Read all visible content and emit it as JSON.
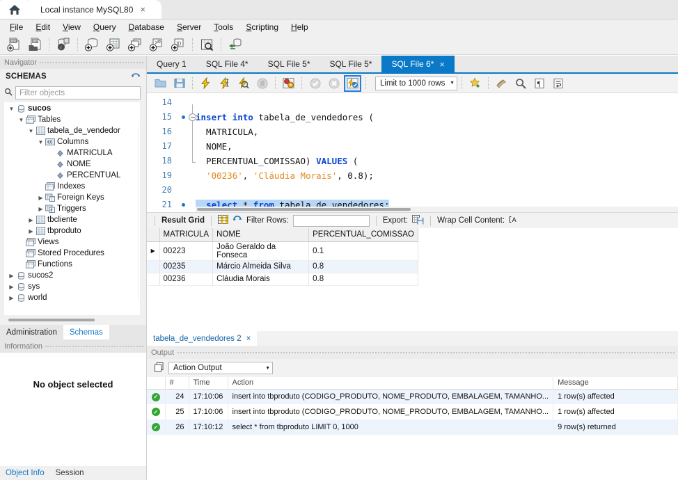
{
  "titlebar": {
    "home_icon": "home-icon",
    "instance_tab": "Local instance MySQL80",
    "close_glyph": "×"
  },
  "menubar": {
    "items": [
      {
        "label": "File"
      },
      {
        "label": "Edit"
      },
      {
        "label": "View"
      },
      {
        "label": "Query"
      },
      {
        "label": "Database"
      },
      {
        "label": "Server"
      },
      {
        "label": "Tools"
      },
      {
        "label": "Scripting"
      },
      {
        "label": "Help"
      }
    ]
  },
  "main_toolbar": {
    "icons": [
      "new-sql-tab-icon",
      "open-sql-script-icon",
      "connection-info-icon",
      "new-schema-icon",
      "new-table-icon",
      "new-view-icon",
      "new-procedure-icon",
      "new-function-icon",
      "inspect-schema-icon",
      "reconnect-server-icon"
    ]
  },
  "navigator": {
    "title": "Navigator",
    "schemas_label": "SCHEMAS",
    "refresh_icon": "refresh-icon",
    "filter_placeholder": "Filter objects",
    "search_icon": "search-icon",
    "tree": [
      {
        "label": "sucos",
        "indent": 0,
        "arrow": "down",
        "icon": "schema-icon",
        "bold": true
      },
      {
        "label": "Tables",
        "indent": 1,
        "arrow": "down",
        "icon": "folder-tables-icon",
        "bold": false
      },
      {
        "label": "tabela_de_vendedor",
        "indent": 2,
        "arrow": "down",
        "icon": "table-icon",
        "bold": false
      },
      {
        "label": "Columns",
        "indent": 3,
        "arrow": "down",
        "icon": "columns-icon",
        "bold": false
      },
      {
        "label": "MATRICULA",
        "indent": 4,
        "arrow": "none",
        "icon": "column-icon",
        "bold": false
      },
      {
        "label": "NOME",
        "indent": 4,
        "arrow": "none",
        "icon": "column-icon",
        "bold": false
      },
      {
        "label": "PERCENTUAL",
        "indent": 4,
        "arrow": "none",
        "icon": "column-icon",
        "bold": false
      },
      {
        "label": "Indexes",
        "indent": 3,
        "arrow": "none",
        "icon": "folder-tables-icon",
        "bold": false
      },
      {
        "label": "Foreign Keys",
        "indent": 3,
        "arrow": "right",
        "icon": "folder-fk-icon",
        "bold": false
      },
      {
        "label": "Triggers",
        "indent": 3,
        "arrow": "right",
        "icon": "folder-trigger-icon",
        "bold": false
      },
      {
        "label": "tbcliente",
        "indent": 2,
        "arrow": "right",
        "icon": "table-icon",
        "bold": false
      },
      {
        "label": "tbproduto",
        "indent": 2,
        "arrow": "right",
        "icon": "table-icon",
        "bold": false
      },
      {
        "label": "Views",
        "indent": 1,
        "arrow": "none",
        "icon": "folder-views-icon",
        "bold": false
      },
      {
        "label": "Stored Procedures",
        "indent": 1,
        "arrow": "none",
        "icon": "folder-proc-icon",
        "bold": false
      },
      {
        "label": "Functions",
        "indent": 1,
        "arrow": "none",
        "icon": "folder-func-icon",
        "bold": false
      },
      {
        "label": "sucos2",
        "indent": 0,
        "arrow": "right",
        "icon": "schema-icon",
        "bold": false
      },
      {
        "label": "sys",
        "indent": 0,
        "arrow": "right",
        "icon": "schema-icon",
        "bold": false
      },
      {
        "label": "world",
        "indent": 0,
        "arrow": "right",
        "icon": "schema-icon",
        "bold": false
      }
    ],
    "tabs": [
      {
        "label": "Administration",
        "active": false
      },
      {
        "label": "Schemas",
        "active": true
      }
    ]
  },
  "information": {
    "title": "Information",
    "empty_text": "No object selected",
    "tabs": [
      {
        "label": "Object Info",
        "active": true
      },
      {
        "label": "Session",
        "active": false
      }
    ]
  },
  "editor": {
    "tabs": [
      {
        "label": "Query 1",
        "active": false,
        "closable": false
      },
      {
        "label": "SQL File 4*",
        "active": false,
        "closable": false
      },
      {
        "label": "SQL File 5*",
        "active": false,
        "closable": false
      },
      {
        "label": "SQL File 5*",
        "active": false,
        "closable": false
      },
      {
        "label": "SQL File 6*",
        "active": true,
        "closable": true
      }
    ],
    "close_glyph": "×",
    "toolbar": {
      "icons": [
        "open-file-icon",
        "save-file-icon",
        "execute-icon",
        "execute-current-statement-icon",
        "explain-icon",
        "stop-icon",
        "toggle-breakpoints-icon",
        "commit-icon",
        "rollback-icon",
        "autocommit-icon"
      ],
      "limit_label": "Limit to 1000 rows",
      "right_icons": [
        "beautify-icon",
        "find-icon",
        "toggle-invisible-icon",
        "wrap-lines-icon"
      ]
    },
    "lines": [
      {
        "no": "14",
        "marker": false,
        "fold": "none",
        "text": ""
      },
      {
        "no": "15",
        "marker": true,
        "fold": "start",
        "text": "insert into tabela_de_vendedores ("
      },
      {
        "no": "16",
        "marker": false,
        "fold": "mid",
        "text": "MATRICULA,"
      },
      {
        "no": "17",
        "marker": false,
        "fold": "mid",
        "text": "NOME,"
      },
      {
        "no": "18",
        "marker": false,
        "fold": "mid",
        "text": "PERCENTUAL_COMISSAO) VALUES ("
      },
      {
        "no": "19",
        "marker": false,
        "fold": "end",
        "text": "'00236', 'Cláudia Morais', 0.8);"
      },
      {
        "no": "20",
        "marker": false,
        "fold": "none",
        "text": ""
      },
      {
        "no": "21",
        "marker": true,
        "fold": "none",
        "text": "select * from tabela de vendedores;"
      }
    ]
  },
  "result_grid": {
    "title": "Result Grid",
    "grid_icon": "grid-view-icon",
    "refresh_icon": "refresh-grid-icon",
    "filter_label": "Filter Rows:",
    "filter_value": "",
    "export_label": "Export:",
    "export_icon": "export-icon",
    "wrap_label": "Wrap Cell Content:",
    "wrap_icon": "wrap-cell-icon",
    "columns": [
      "MATRICULA",
      "NOME",
      "PERCENTUAL_COMISSAO"
    ],
    "rows": [
      {
        "marker": "▶",
        "MATRICULA": "00223",
        "NOME": "João Geraldo da Fonseca",
        "PERCENTUAL_COMISSAO": "0.1"
      },
      {
        "marker": "",
        "MATRICULA": "00235",
        "NOME": "Márcio Almeida Silva",
        "PERCENTUAL_COMISSAO": "0.8"
      },
      {
        "marker": "",
        "MATRICULA": "00236",
        "NOME": "Cláudia Morais",
        "PERCENTUAL_COMISSAO": "0.8"
      }
    ]
  },
  "result_tabs": [
    {
      "label": "tabela_de_vendedores 2",
      "active": true
    }
  ],
  "output": {
    "title": "Output",
    "copy_icon": "copy-icon",
    "mode": "Action Output",
    "columns": [
      "#",
      "Time",
      "Action",
      "Message"
    ],
    "rows": [
      {
        "status": "success",
        "num": "24",
        "time": "17:10:06",
        "action": "insert into tbproduto (CODIGO_PRODUTO, NOME_PRODUTO, EMBALAGEM, TAMANHO...",
        "message": "1 row(s) affected"
      },
      {
        "status": "success",
        "num": "25",
        "time": "17:10:06",
        "action": "insert into tbproduto (CODIGO_PRODUTO, NOME_PRODUTO, EMBALAGEM, TAMANHO...",
        "message": "1 row(s) affected"
      },
      {
        "status": "success",
        "num": "26",
        "time": "17:10:12",
        "action": "select * from tbproduto LIMIT 0, 1000",
        "message": "9 row(s) returned"
      }
    ],
    "status_glyph": "✓"
  },
  "colors": {
    "accent": "#0a79c7",
    "keyword": "#0a48d2",
    "string": "#e08a1e",
    "line_number": "#3f7fb5",
    "selection": "#b6d7f5",
    "success": "#33a532",
    "alt_row": "#eef4fc"
  }
}
